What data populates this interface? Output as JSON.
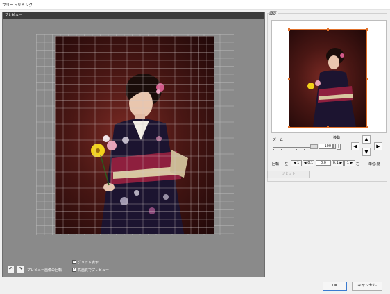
{
  "window": {
    "title": "フリートリミング"
  },
  "preview": {
    "header": "プレビュー",
    "rotate_label": "プレビュー画像の回転",
    "grid_checkbox": {
      "label": "グリッド表示",
      "checked": true
    },
    "hq_checkbox": {
      "label": "高画質でプレビュー",
      "checked": true
    }
  },
  "settings": {
    "label": "設定",
    "zoom_label": "ズーム",
    "zoom_value": "100",
    "move_label": "移動",
    "rotation_label": "回転",
    "left_label": "左",
    "right_label": "右",
    "unit_label": "単位:度",
    "rotation_value": "0.0",
    "rot_buttons": {
      "minus1": "1",
      "minus01": "0.1",
      "plus01": "0.1",
      "plus1": "1"
    },
    "reset_label": "リセット"
  },
  "dialog": {
    "ok_label": "OK",
    "cancel_label": "キャンセル"
  },
  "icons": {
    "rotate_ccw": "rotate-left-icon",
    "rotate_cw": "rotate-right-icon",
    "up": "arrow-up-icon",
    "down": "arrow-down-icon",
    "left": "arrow-left-icon",
    "right": "arrow-right-icon"
  },
  "colors": {
    "crop_frame": "#e0702a",
    "preview_bg": "#8a8a8a",
    "header_bg": "#3c3c3c"
  }
}
